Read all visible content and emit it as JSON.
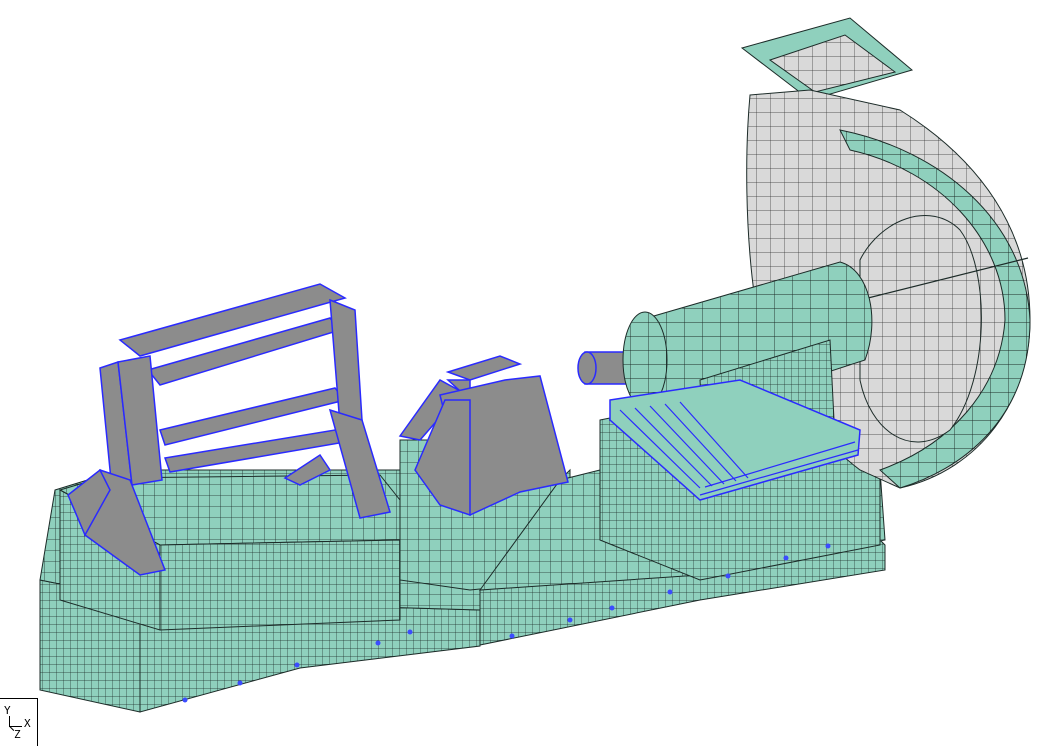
{
  "viewport": {
    "background": "#ffffff"
  },
  "colors": {
    "mesh_fill": "#8fd0bd",
    "mesh_line": "#1c2b28",
    "plate_fill": "#8c8c8c",
    "plate_edge": "#2a2aff",
    "casing_fill": "#d9d9d9",
    "node_marker": "#3b4cff"
  },
  "icons": {
    "axis_triad": "xyz-axis-triad-icon"
  },
  "axis_triad": {
    "y": "Y",
    "x": "X",
    "z": "Z"
  }
}
